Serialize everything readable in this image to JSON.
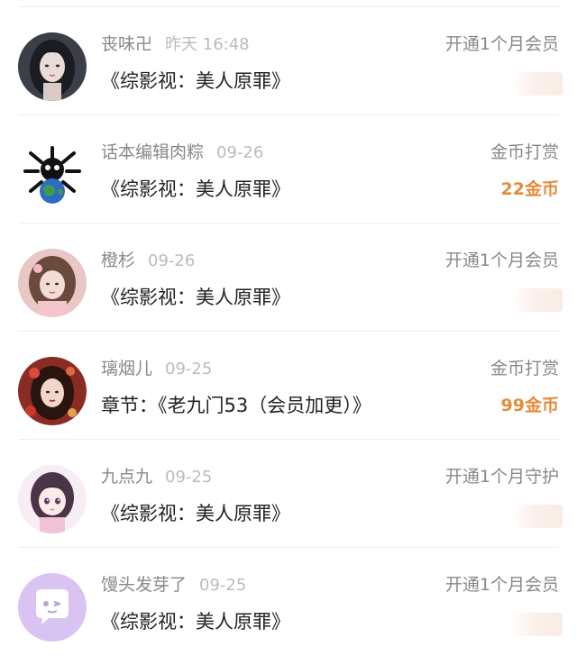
{
  "records": [
    {
      "avatar_icon": "avatar-girl-dark-hair-icon",
      "username": "丧味卍",
      "time": "昨天 16:48",
      "work": "《综影视：美人原罪》",
      "action": "开通1个月会员",
      "amount": ""
    },
    {
      "avatar_icon": "avatar-globe-creature-icon",
      "username": "话本编辑肉粽",
      "time": "09-26",
      "work": "《综影视：美人原罪》",
      "action": "金币打赏",
      "amount": "22金币"
    },
    {
      "avatar_icon": "avatar-girl-pink-icon",
      "username": "橙杉",
      "time": "09-26",
      "work": "《综影视：美人原罪》",
      "action": "开通1个月会员",
      "amount": ""
    },
    {
      "avatar_icon": "avatar-girl-red-flowers-icon",
      "username": "璃烟儿",
      "time": "09-25",
      "work": "章节：《老九门53（会员加更）》",
      "action": "金币打赏",
      "amount": "99金币"
    },
    {
      "avatar_icon": "avatar-anime-girl-icon",
      "username": "九点九",
      "time": "09-25",
      "work": "《综影视：美人原罪》",
      "action": "开通1个月守护",
      "amount": ""
    },
    {
      "avatar_icon": "avatar-default-chat-bubble-icon",
      "username": "馒头发芽了",
      "time": "09-25",
      "work": "《综影视：美人原罪》",
      "action": "开通1个月会员",
      "amount": ""
    }
  ],
  "colors": {
    "amount": "#e58b3c",
    "username": "#888888",
    "time": "#bbbbbb",
    "work": "#222222",
    "default_avatar_bg": "#d8c3f3"
  }
}
